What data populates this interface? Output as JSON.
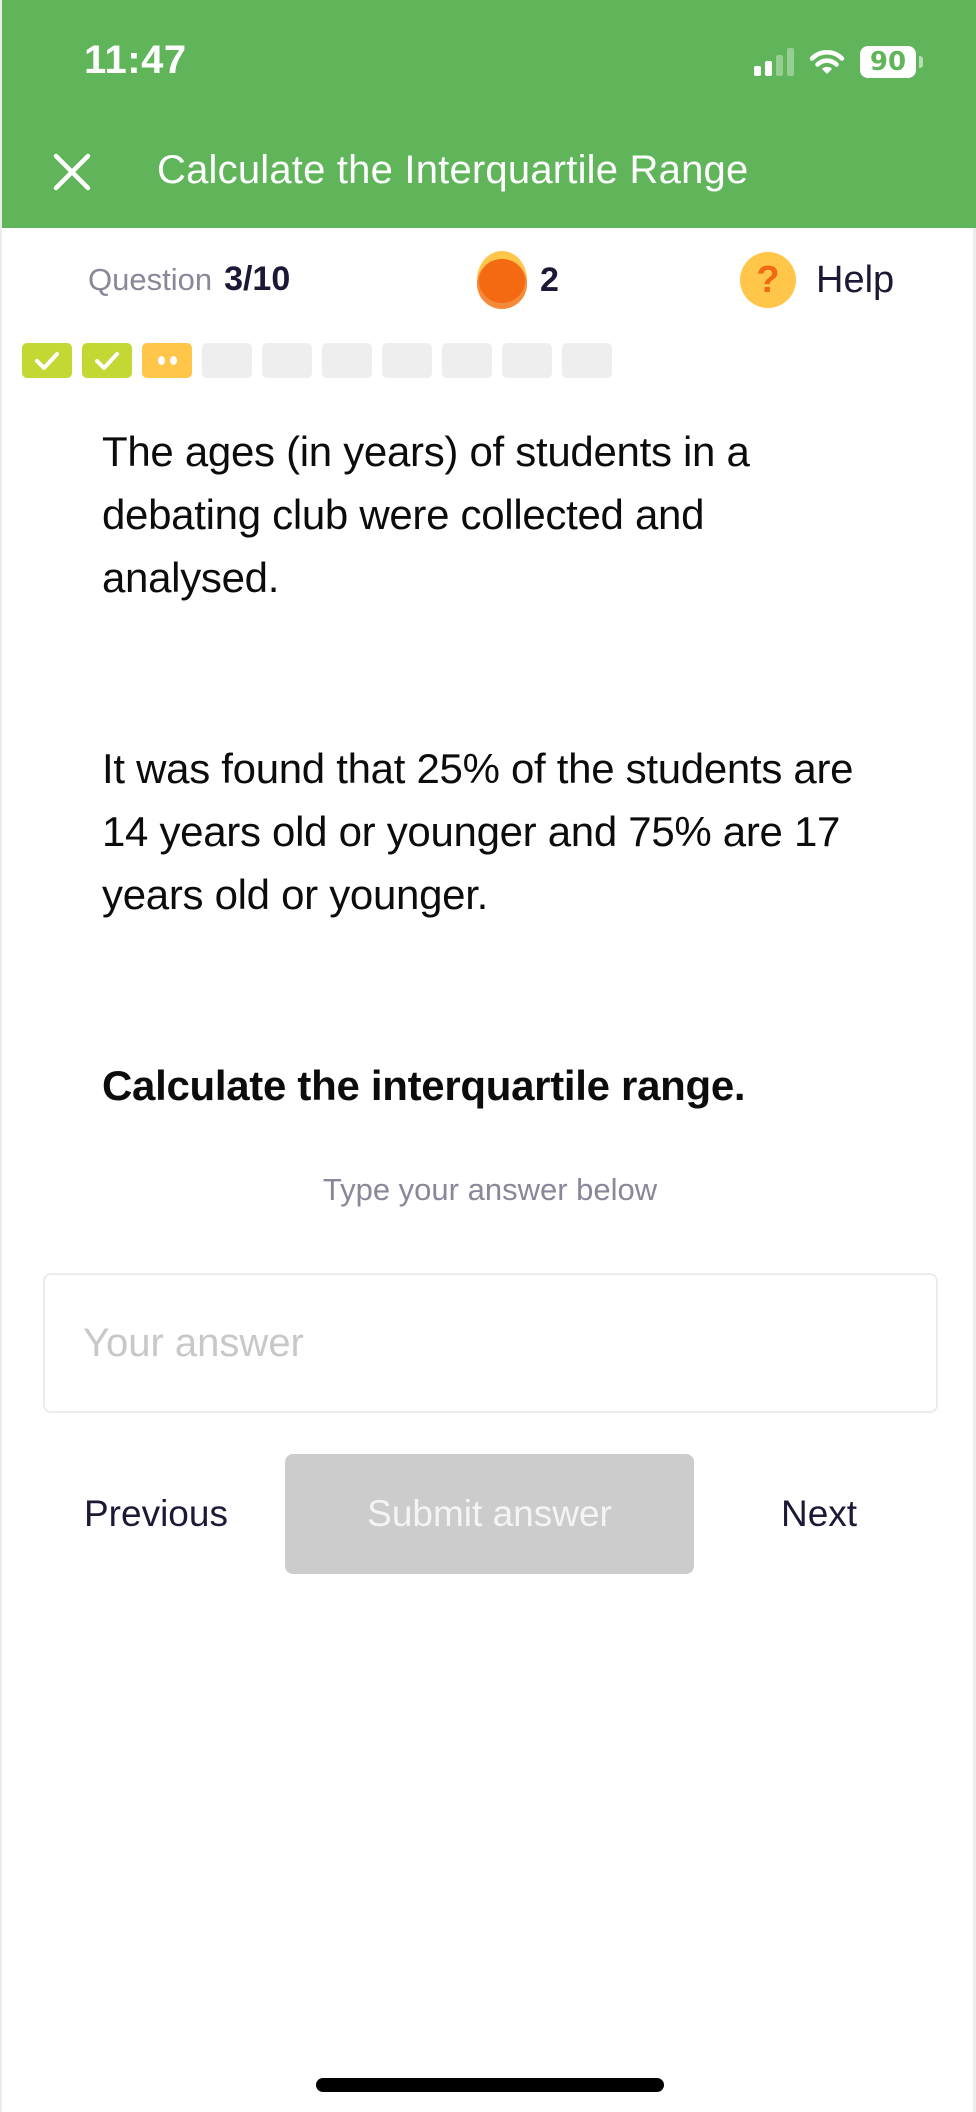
{
  "status_bar": {
    "time": "11:47",
    "battery_level": "90",
    "signal_bars_active": 2,
    "signal_bars_total": 4
  },
  "header": {
    "close_icon": "close-icon",
    "title": "Calculate the Interquartile Range",
    "background_color": "#60b55a"
  },
  "info": {
    "question_label": "Question",
    "question_value": "3/10",
    "coin_icon": "coin-icon",
    "coin_count": "2",
    "help_icon": "question-mark-icon",
    "help_symbol": "?",
    "help_label": "Help"
  },
  "progress": {
    "total": 10,
    "current_index": 3,
    "items": [
      {
        "state": "correct",
        "icon": "check-icon"
      },
      {
        "state": "correct",
        "icon": "check-icon"
      },
      {
        "state": "current",
        "icon": "dots-icon"
      },
      {
        "state": "pending"
      },
      {
        "state": "pending"
      },
      {
        "state": "pending"
      },
      {
        "state": "pending"
      },
      {
        "state": "pending"
      },
      {
        "state": "pending"
      },
      {
        "state": "pending"
      }
    ],
    "colors": {
      "correct": "#c4d833",
      "current": "#ffc64a",
      "pending": "#eeeeee"
    }
  },
  "question": {
    "paragraphs": [
      "The ages (in years) of students in a debating club were collected and analysed.",
      "It was found that 25% of the students are 14 years old or younger and 75% are 17 years old or younger.",
      "Calculate the interquartile range."
    ],
    "hint": "Type your answer below"
  },
  "answer": {
    "value": "",
    "placeholder": "Your answer"
  },
  "nav": {
    "previous_label": "Previous",
    "submit_label": "Submit answer",
    "submit_disabled": true,
    "next_label": "Next"
  }
}
